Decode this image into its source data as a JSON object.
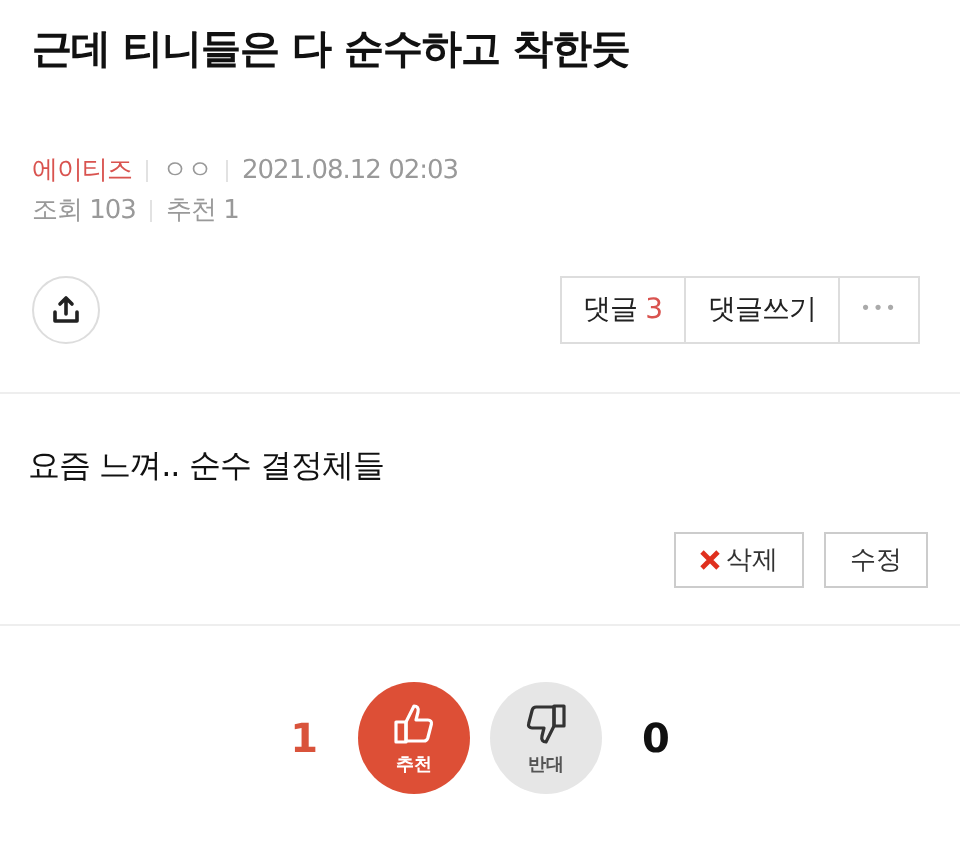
{
  "post": {
    "title": "근데 티니들은 다 순수하고 착한듯",
    "category": "에이티즈",
    "author": "ㅇㅇ",
    "datetime": "2021.08.12 02:03",
    "views_label": "조회",
    "views": "103",
    "recommend_label": "추천",
    "recommend": "1"
  },
  "actions": {
    "comments_label": "댓글",
    "comments_count": "3",
    "write_comment": "댓글쓰기",
    "more": "•••"
  },
  "body": "요즘 느껴.. 순수 결정체들",
  "edit_buttons": [
    {
      "kind": "delete",
      "label": "삭제"
    },
    {
      "kind": "edit",
      "label": "수정"
    }
  ],
  "votes": [
    {
      "kind": "up",
      "count": "1",
      "label": "추천",
      "selected": true
    },
    {
      "kind": "down",
      "count": "0",
      "label": "반대",
      "selected": false
    }
  ]
}
